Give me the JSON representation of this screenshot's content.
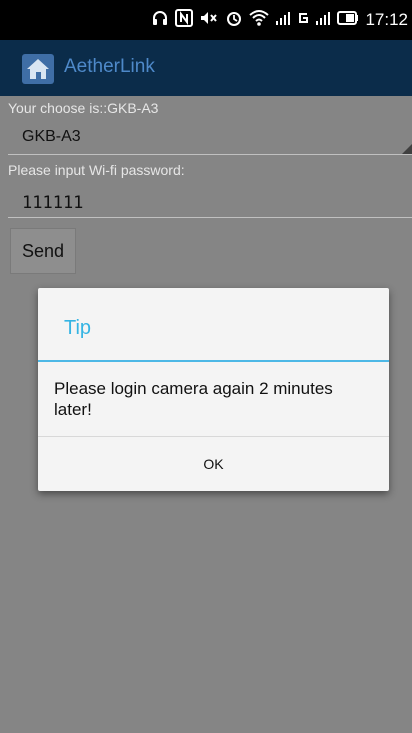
{
  "status_bar": {
    "icons": [
      "headset-icon",
      "nfc-icon",
      "mute-icon",
      "alarm-icon",
      "wifi-icon",
      "signal-3g-icon",
      "network-g-icon",
      "signal-2-icon",
      "battery-icon"
    ],
    "time": "17:12"
  },
  "app": {
    "title": "AetherLink"
  },
  "form": {
    "choose_label": "Your choose is::GKB-A3",
    "selected_device": "GKB-A3",
    "password_label": "Please input Wi-fi password:",
    "password_value": "111111",
    "send_label": "Send"
  },
  "dialog": {
    "title": "Tip",
    "message": "Please login camera again 2 minutes later!",
    "ok_label": "OK"
  },
  "colors": {
    "appbar": "#0b2c4a",
    "title": "#4e89c9",
    "dialog_accent": "#35b4e3",
    "background_dim": "#858585"
  }
}
